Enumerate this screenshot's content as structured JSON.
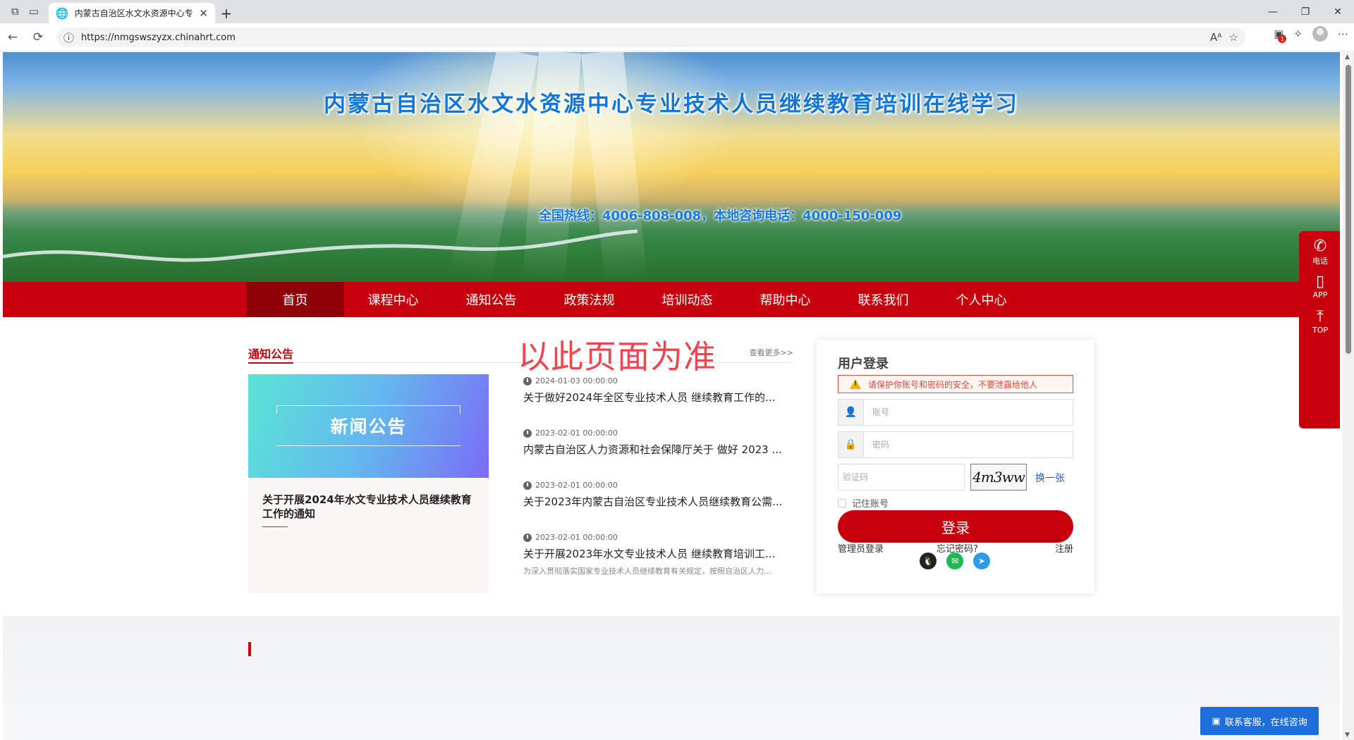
{
  "browser": {
    "tab_title": "内蒙古自治区水文水资源中心专业",
    "url": "https://nmgswszyzx.chinahrt.com",
    "notification_count": "1"
  },
  "banner": {
    "title": "内蒙古自治区水文水资源中心专业技术人员继续教育培训在线学习",
    "hotline": "全国热线：4006-808-008，本地咨询电话：4000-150-009"
  },
  "nav": {
    "items": [
      "首页",
      "课程中心",
      "通知公告",
      "政策法规",
      "培训动态",
      "帮助中心",
      "联系我们",
      "个人中心"
    ]
  },
  "notices": {
    "section_title": "通知公告",
    "watermark": "以此页面为准",
    "more": "查看更多>>",
    "featured": {
      "image_label": "新闻公告",
      "title": "关于开展2024年水文专业技术人员继续教育工作的通知"
    },
    "items": [
      {
        "date": "2024-01-03 00:00:00",
        "title": "关于做好2024年全区专业技术人员 继续教育工作的..."
      },
      {
        "date": "2023-02-01 00:00:00",
        "title": "内蒙古自治区人力资源和社会保障厅关于 做好 2023 ..."
      },
      {
        "date": "2023-02-01 00:00:00",
        "title": "关于2023年内蒙古自治区专业技术人员继续教育公需..."
      },
      {
        "date": "2023-02-01 00:00:00",
        "title": "关于开展2023年水文专业技术人员 继续教育培训工...",
        "summary": "为深入贯彻落实国家专业技术人员继续教育有关规定，按照自治区人力..."
      }
    ]
  },
  "login": {
    "title": "用户登录",
    "warning": "请保护你账号和密码的安全，不要泄露给他人",
    "account_placeholder": "账号",
    "password_placeholder": "密码",
    "captcha_placeholder": "验证码",
    "captcha_text": "4m3ww",
    "refresh_label": "换一张",
    "remember_label": "记住账号",
    "submit_label": "登录",
    "admin_link": "管理员登录",
    "forgot_link": "忘记密码?",
    "register_link": "注册"
  },
  "sidefloat": {
    "phone_label": "电话",
    "app_label": "APP",
    "top_label": "TOP"
  },
  "chat": {
    "label": "联系客服，在线咨询"
  },
  "colors": {
    "brand_red": "#c8000d",
    "nav_active": "#8f0008",
    "link_blue": "#1c5fc7",
    "chat_blue": "#1e6fd9"
  }
}
